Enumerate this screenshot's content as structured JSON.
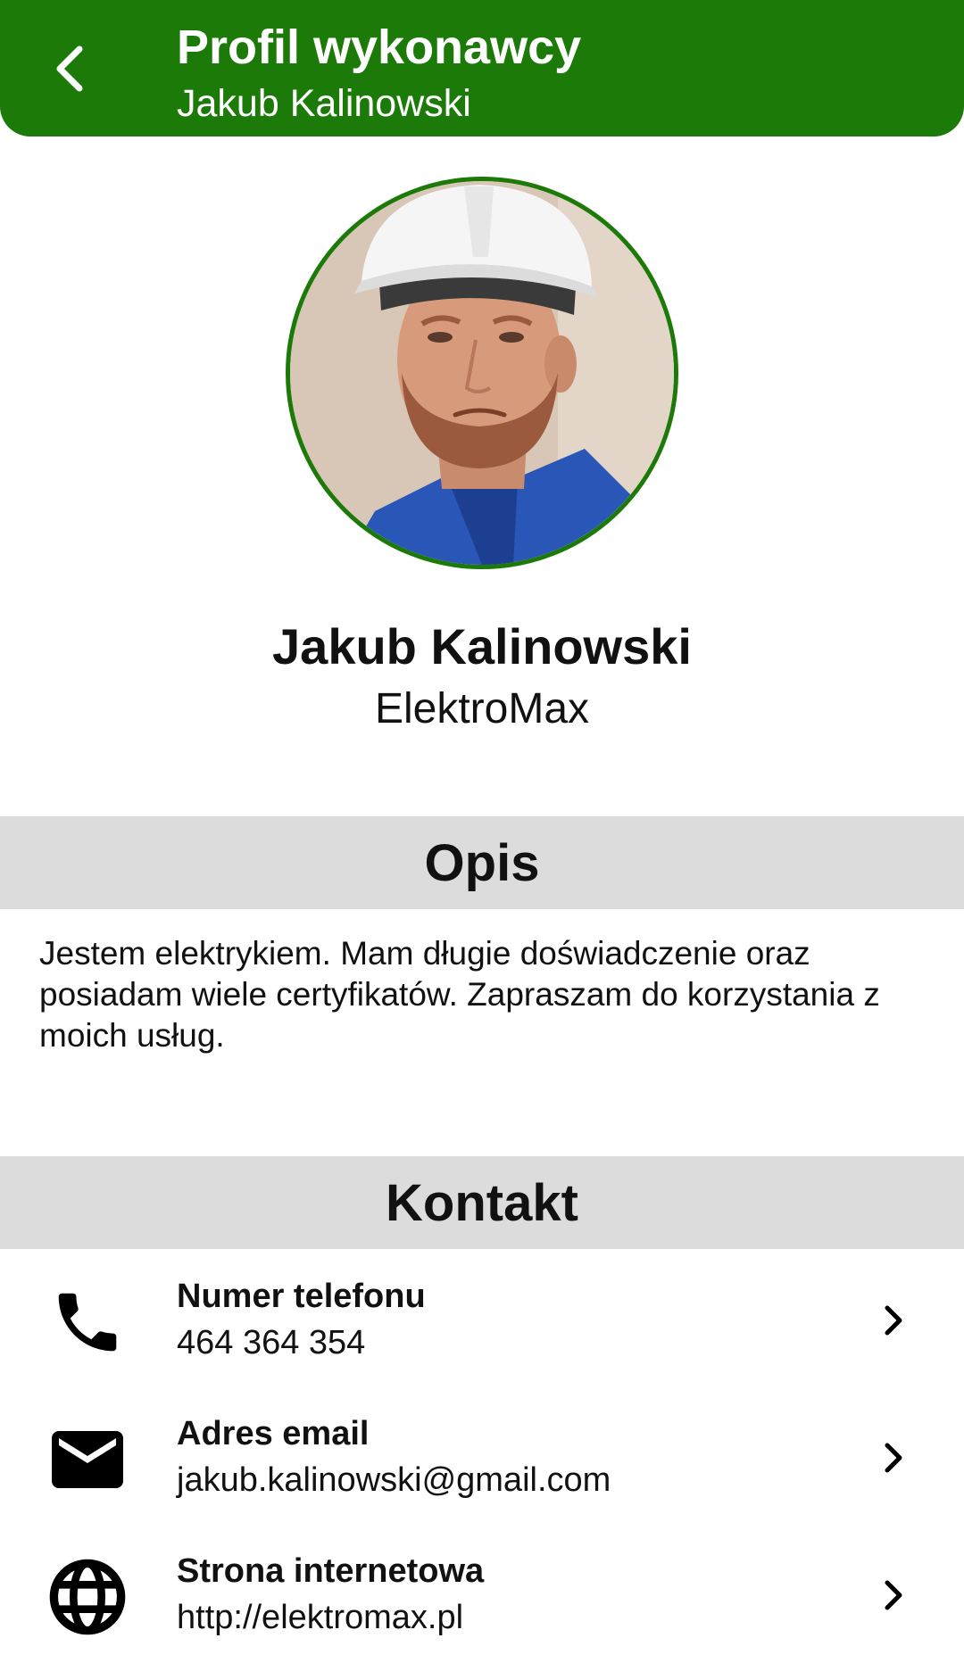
{
  "app_bar": {
    "title": "Profil wykonawcy",
    "subtitle": "Jakub Kalinowski",
    "background_color": "#1c7a08",
    "back_icon": "chevron-left-icon"
  },
  "profile": {
    "name": "Jakub Kalinowski",
    "company": "ElektroMax",
    "avatar_border_color": "#1c7a08"
  },
  "description_section": {
    "header": "Opis",
    "text": "Jestem elektrykiem. Mam długie doświadczenie oraz posiadam wiele certyfikatów. Zapraszam do korzystania z moich usług."
  },
  "contact_section": {
    "header": "Kontakt",
    "items": [
      {
        "icon": "phone-icon",
        "label": "Numer telefonu",
        "value": "464 364 354"
      },
      {
        "icon": "mail-icon",
        "label": "Adres email",
        "value": "jakub.kalinowski@gmail.com"
      },
      {
        "icon": "globe-icon",
        "label": "Strona internetowa",
        "value": "http://elektromax.pl"
      }
    ]
  }
}
